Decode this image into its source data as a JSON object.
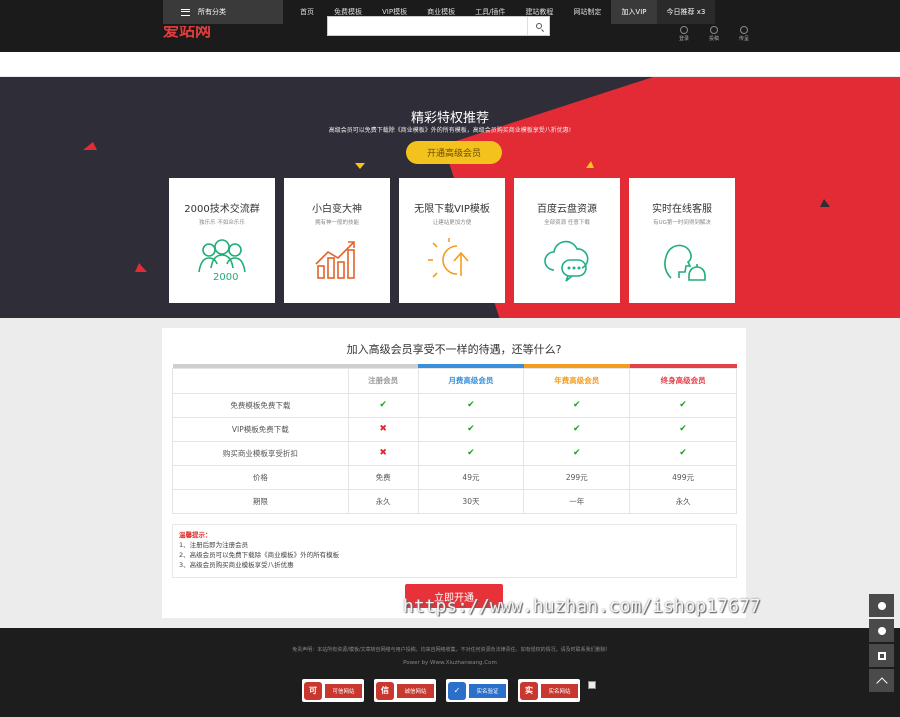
{
  "header": {
    "category_label": "所有分类",
    "nav": [
      "首页",
      "免费模板",
      "VIP模板",
      "商业模板",
      "工具/插件",
      "建站教程",
      "网站制定",
      "加入VIP",
      "今日推荐"
    ],
    "today_count": "x3",
    "logo_text": "爱站网",
    "search_placeholder": "",
    "icons": [
      {
        "label": "登录",
        "icon": "user-icon"
      },
      {
        "label": "投稿",
        "icon": "upload-icon"
      },
      {
        "label": "传呈",
        "icon": "share-icon"
      }
    ]
  },
  "hero": {
    "title": "精彩特权推荐",
    "subtitle": "高级会员可以免费下载除《商业模板》外的所有模板，高级会员购买商业模板享受八折优惠!",
    "button": "开通高级会员",
    "cards": [
      {
        "title": "2000技术交流群",
        "desc": "独乐乐 不如众乐乐",
        "icon": "group-2000-icon",
        "color": "#1fae74"
      },
      {
        "title": "小白变大神",
        "desc": "拥有神一般的技能",
        "icon": "growth-chart-icon",
        "color": "#e2632a"
      },
      {
        "title": "无限下载VIP模板",
        "desc": "让建站更加方便",
        "icon": "sun-upload-icon",
        "color": "#f39c1f"
      },
      {
        "title": "百度云盘资源",
        "desc": "全部资源 任意下载",
        "icon": "cloud-chat-icon",
        "color": "#1fae8a"
      },
      {
        "title": "实时在线客服",
        "desc": "有UG第一时间得到解决",
        "icon": "support-bell-icon",
        "color": "#1fae74"
      }
    ]
  },
  "comparison": {
    "title": "加入高级会员享受不一样的待遇，还等什么?",
    "columns": [
      {
        "label": "注册会员",
        "color": "#aaaaaa"
      },
      {
        "label": "月费高级会员",
        "color": "#3b8fd8"
      },
      {
        "label": "年费高级会员",
        "color": "#f39c1f"
      },
      {
        "label": "终身高级会员",
        "color": "#e2424a"
      }
    ],
    "rows": [
      {
        "feature": "免费模板免费下载",
        "cells": [
          "ok",
          "ok",
          "ok",
          "ok"
        ]
      },
      {
        "feature": "VIP模板免费下载",
        "cells": [
          "no",
          "ok",
          "ok",
          "ok"
        ]
      },
      {
        "feature": "购买商业模板享受折扣",
        "cells": [
          "no",
          "ok",
          "ok",
          "ok"
        ]
      },
      {
        "feature": "价格",
        "cells": [
          "免费",
          "49元",
          "299元",
          "499元"
        ]
      },
      {
        "feature": "期限",
        "cells": [
          "永久",
          "30天",
          "一年",
          "永久"
        ]
      }
    ],
    "notes_title": "温馨提示：",
    "notes": [
      "1、注册后即为注册会员",
      "2、高级会员可以免费下载除《商业模板》外的所有模板",
      "3、高级会员购买商业模板享受八折优惠"
    ],
    "open_button": "立即开通"
  },
  "watermark": "https://www.huzhan.com/ishop17677",
  "footer": {
    "disclaimer": "免责声明：本站所有资源/模板/文章转自网络与用户投稿，均来自网络收集，不对任何资源负法律责任。如有侵权的情况，请及时联系我们删除!",
    "power": "Power by Www.Xiuzhanwang.Com",
    "badges": [
      {
        "label": "可信网站",
        "color": "#c8382e"
      },
      {
        "label": "诚信网站",
        "color": "#c8382e"
      },
      {
        "label": "实名验证",
        "color": "#2a6fc9"
      },
      {
        "label": "实名网站",
        "color": "#c8382e"
      }
    ],
    "badge_glyphs": [
      "可",
      "信",
      "✓",
      "实"
    ]
  },
  "ok_glyph": "✔",
  "no_glyph": "✖"
}
